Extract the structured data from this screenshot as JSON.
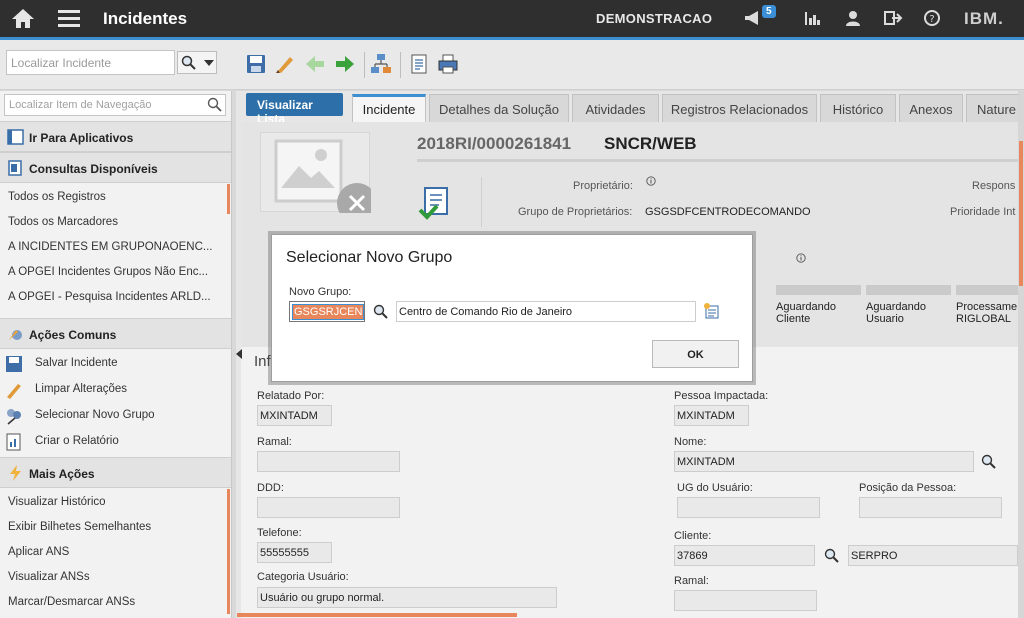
{
  "header": {
    "title": "Incidentes",
    "org": "DEMONSTRACAO",
    "notification_count": "5",
    "brand": "IBM."
  },
  "toolbar": {
    "search_placeholder": "Localizar Incidente"
  },
  "nav": {
    "search_placeholder": "Localizar Item de Navegação",
    "go_to_apps": "Ir Para Aplicativos",
    "queries_title": "Consultas Disponíveis",
    "queries": [
      "Todos os Registros",
      "Todos os Marcadores",
      "A INCIDENTES EM GRUPONAOENC...",
      "A OPGEI Incidentes Grupos Não Enc...",
      "A OPGEI - Pesquisa Incidentes ARLD..."
    ],
    "common_title": "Ações Comuns",
    "common": [
      "Salvar Incidente",
      "Limpar Alterações",
      "Selecionar Novo Grupo",
      "Criar o Relatório"
    ],
    "more_title": "Mais Ações",
    "more": [
      "Visualizar Histórico",
      "Exibir Bilhetes Semelhantes",
      "Aplicar ANS",
      "Visualizar ANSs",
      "Marcar/Desmarcar ANSs"
    ]
  },
  "main": {
    "list_button": "Visualizar Lista",
    "tabs": [
      "Incidente",
      "Detalhes da Solução",
      "Atividades",
      "Registros Relacionados",
      "Histórico",
      "Anexos",
      "Nature"
    ],
    "record_number": "2018RI/0000261841",
    "record_name": "SNCR/WEB",
    "owner_label": "Proprietário:",
    "owner_group_label": "Grupo de Proprietários:",
    "owner_group_value": "GSGSDFCENTRODECOMANDO",
    "responsible_label": "Respons",
    "priority_label": "Prioridade Int",
    "status": [
      {
        "line1": "Aguardando",
        "line2": "Cliente"
      },
      {
        "line1": "Aguardando",
        "line2": "Usuario"
      },
      {
        "line1": "Processame",
        "line2": "RIGLOBAL"
      }
    ],
    "info_title": "Info",
    "fields": {
      "reported_by_label": "Relatado Por:",
      "reported_by": "MXINTADM",
      "ramal_label": "Ramal:",
      "ramal": "",
      "ddd_label": "DDD:",
      "ddd": "",
      "phone_label": "Telefone:",
      "phone": "55555555",
      "user_category_label": "Categoria Usuário:",
      "user_category": "Usuário ou grupo normal.",
      "affected_label": "Pessoa Impactada:",
      "affected": "MXINTADM",
      "name_label": "Nome:",
      "name": "MXINTADM",
      "ug_label": "UG do Usuário:",
      "ug": "",
      "position_label": "Posição da Pessoa:",
      "position": "",
      "client_label": "Cliente:",
      "client_code": "37869",
      "client_name": "SERPRO",
      "ramal2_label": "Ramal:"
    }
  },
  "dialog": {
    "title": "Selecionar Novo Grupo",
    "field_label": "Novo Grupo:",
    "field_value": "GSGSRJCEN",
    "description": "Centro de Comando Rio de Janeiro",
    "ok_label": "OK"
  },
  "colors": {
    "accent": "#3c8fd0",
    "highlight": "#e8865c",
    "topbar": "#2f2f2f"
  }
}
